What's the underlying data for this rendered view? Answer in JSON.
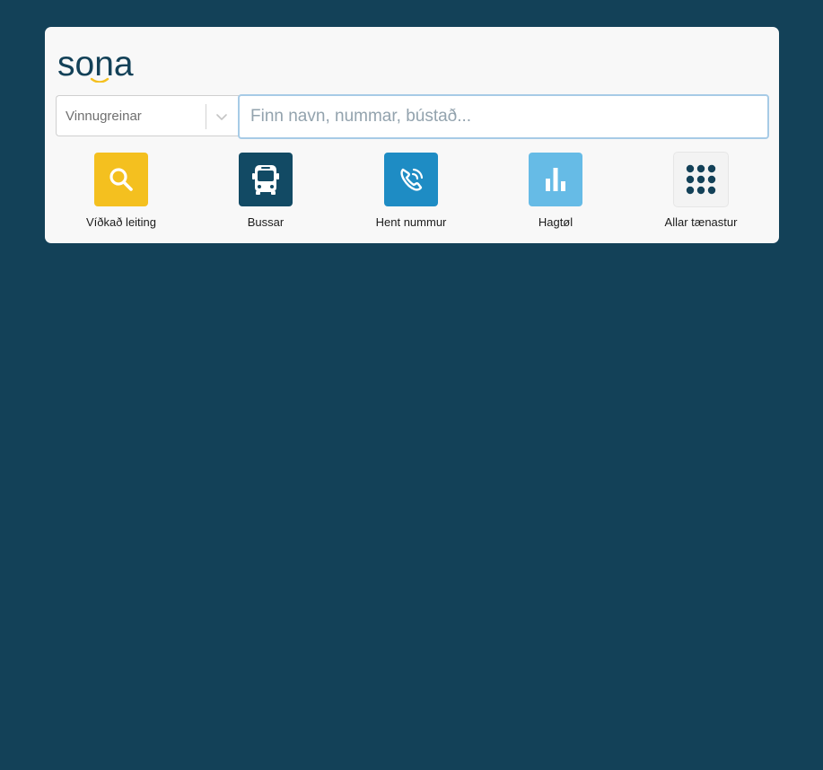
{
  "brand": {
    "logo_text": "sona"
  },
  "search": {
    "category_label": "Vinnugreinar",
    "placeholder": "Finn navn, nummar, bústað..."
  },
  "services": [
    {
      "label": "Víðkað leiting",
      "icon": "search-icon",
      "color": "#f4c01f"
    },
    {
      "label": "Bussar",
      "icon": "bus-icon",
      "color": "#124a64"
    },
    {
      "label": "Hent nummur",
      "icon": "phone-call-icon",
      "color": "#1e8cc4"
    },
    {
      "label": "Hagtøl",
      "icon": "bar-chart-icon",
      "color": "#66bbe6"
    },
    {
      "label": "Allar tænastur",
      "icon": "grid-dots-icon",
      "color": "#f3f3f3"
    }
  ],
  "colors": {
    "background": "#134158",
    "card": "#f8f8f8",
    "logo": "#134158",
    "logo_accent": "#f4c01f",
    "input_focus_border": "#a7cbe6"
  }
}
